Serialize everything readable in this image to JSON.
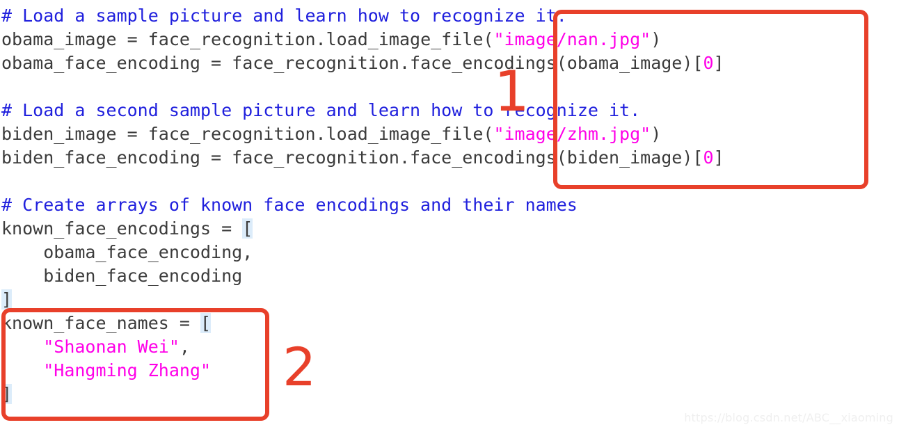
{
  "editor": {
    "language": "python",
    "background_color": "#ffffff",
    "colors": {
      "comment": "#2020dd",
      "code": "#3b3b3b",
      "string": "#ff00e8",
      "number": "#ff00e8",
      "bracket_highlight": "#dcecfa",
      "annotation": "#e8402a"
    },
    "lines": [
      {
        "id": "line-1",
        "tokens": [
          {
            "t": "comment",
            "s": "# Load a sample picture and learn how to recognize it."
          }
        ]
      },
      {
        "id": "line-2",
        "tokens": [
          {
            "t": "name",
            "s": "obama_image "
          },
          {
            "t": "op",
            "s": "= "
          },
          {
            "t": "name",
            "s": "face_recognition.load_image_file("
          },
          {
            "t": "str",
            "s": "\"image/nan.jpg\""
          },
          {
            "t": "punct",
            "s": ")"
          }
        ]
      },
      {
        "id": "line-3",
        "tokens": [
          {
            "t": "name",
            "s": "obama_face_encoding "
          },
          {
            "t": "op",
            "s": "= "
          },
          {
            "t": "name",
            "s": "face_recognition.face_encodings(obama_image)["
          },
          {
            "t": "num",
            "s": "0"
          },
          {
            "t": "punct",
            "s": "]"
          }
        ]
      },
      {
        "id": "line-4",
        "tokens": []
      },
      {
        "id": "line-5",
        "tokens": [
          {
            "t": "comment",
            "s": "# Load a second sample picture and learn how to recognize it."
          }
        ]
      },
      {
        "id": "line-6",
        "tokens": [
          {
            "t": "name",
            "s": "biden_image "
          },
          {
            "t": "op",
            "s": "= "
          },
          {
            "t": "name",
            "s": "face_recognition.load_image_file("
          },
          {
            "t": "str",
            "s": "\"image/zhm.jpg\""
          },
          {
            "t": "punct",
            "s": ")"
          }
        ]
      },
      {
        "id": "line-7",
        "tokens": [
          {
            "t": "name",
            "s": "biden_face_encoding "
          },
          {
            "t": "op",
            "s": "= "
          },
          {
            "t": "name",
            "s": "face_recognition.face_encodings(biden_image)["
          },
          {
            "t": "num",
            "s": "0"
          },
          {
            "t": "punct",
            "s": "]"
          }
        ]
      },
      {
        "id": "line-8",
        "tokens": []
      },
      {
        "id": "line-9",
        "tokens": [
          {
            "t": "comment",
            "s": "# Create arrays of known face encodings and their names"
          }
        ]
      },
      {
        "id": "line-10",
        "tokens": [
          {
            "t": "name",
            "s": "known_face_encodings "
          },
          {
            "t": "op",
            "s": "= "
          },
          {
            "t": "bracket",
            "s": "["
          }
        ]
      },
      {
        "id": "line-11",
        "tokens": [
          {
            "t": "name",
            "s": "    obama_face_encoding,"
          }
        ]
      },
      {
        "id": "line-12",
        "tokens": [
          {
            "t": "name",
            "s": "    biden_face_encoding"
          }
        ]
      },
      {
        "id": "line-13",
        "tokens": [
          {
            "t": "bracket",
            "s": "]"
          }
        ]
      },
      {
        "id": "line-14",
        "tokens": [
          {
            "t": "name",
            "s": "known_face_names "
          },
          {
            "t": "op",
            "s": "= "
          },
          {
            "t": "bracket",
            "s": "["
          }
        ]
      },
      {
        "id": "line-15",
        "tokens": [
          {
            "t": "punct",
            "s": "    "
          },
          {
            "t": "str",
            "s": "\"Shaonan Wei\""
          },
          {
            "t": "punct",
            "s": ","
          }
        ]
      },
      {
        "id": "line-16",
        "tokens": [
          {
            "t": "punct",
            "s": "    "
          },
          {
            "t": "str",
            "s": "\"Hangming Zhang\""
          }
        ]
      },
      {
        "id": "line-17",
        "tokens": [
          {
            "t": "bracket",
            "s": "]"
          }
        ]
      }
    ]
  },
  "annotations": {
    "box_1_label": "1",
    "box_2_label": "2"
  },
  "watermark": {
    "text": "https://blog.csdn.net/ABC__xiaoming"
  }
}
